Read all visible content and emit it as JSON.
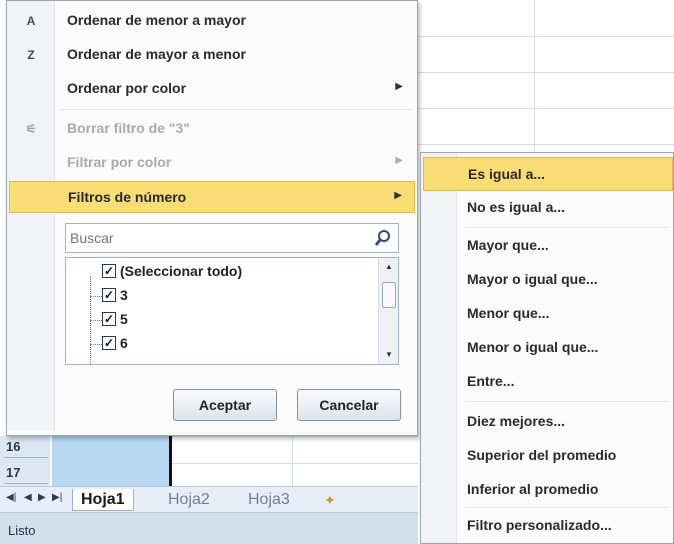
{
  "menu": {
    "items": [
      {
        "label": "Ordenar de menor a mayor",
        "icon": "sort-ascending-icon",
        "glyph": "A↓",
        "disabled": false,
        "submenu": false
      },
      {
        "label": "Ordenar de mayor a menor",
        "icon": "sort-descending-icon",
        "glyph": "Z↓",
        "disabled": false,
        "submenu": false
      },
      {
        "label": "Ordenar por color",
        "icon": "",
        "glyph": "",
        "disabled": false,
        "submenu": true
      },
      {
        "label": "Borrar filtro de \"3\"",
        "icon": "clear-filter-icon",
        "glyph": "⚟",
        "disabled": true,
        "submenu": false
      },
      {
        "label": "Filtrar por color",
        "icon": "",
        "glyph": "",
        "disabled": true,
        "submenu": true
      },
      {
        "label": "Filtros de número",
        "icon": "",
        "glyph": "",
        "disabled": false,
        "submenu": true,
        "highlighted": true
      }
    ],
    "search_placeholder": "Buscar",
    "list": [
      {
        "label": "(Seleccionar todo)",
        "checked": true
      },
      {
        "label": "3",
        "checked": true
      },
      {
        "label": "5",
        "checked": true
      },
      {
        "label": "6",
        "checked": true
      }
    ],
    "accept_label": "Aceptar",
    "cancel_label": "Cancelar"
  },
  "submenu": {
    "items": [
      "Es igual a...",
      "No es igual a...",
      "Mayor que...",
      "Mayor o igual que...",
      "Menor que...",
      "Menor o igual que...",
      "Entre...",
      "Diez mejores...",
      "Superior del promedio",
      "Inferior al promedio",
      "Filtro personalizado..."
    ]
  },
  "sheet": {
    "rows": [
      "16",
      "17"
    ],
    "tabs": [
      "Hoja1",
      "Hoja2",
      "Hoja3"
    ],
    "active_tab": "Hoja1",
    "status": "Listo"
  },
  "colors": {
    "highlight": "#f8dc74",
    "selected_cell": "#b7d7f2"
  }
}
